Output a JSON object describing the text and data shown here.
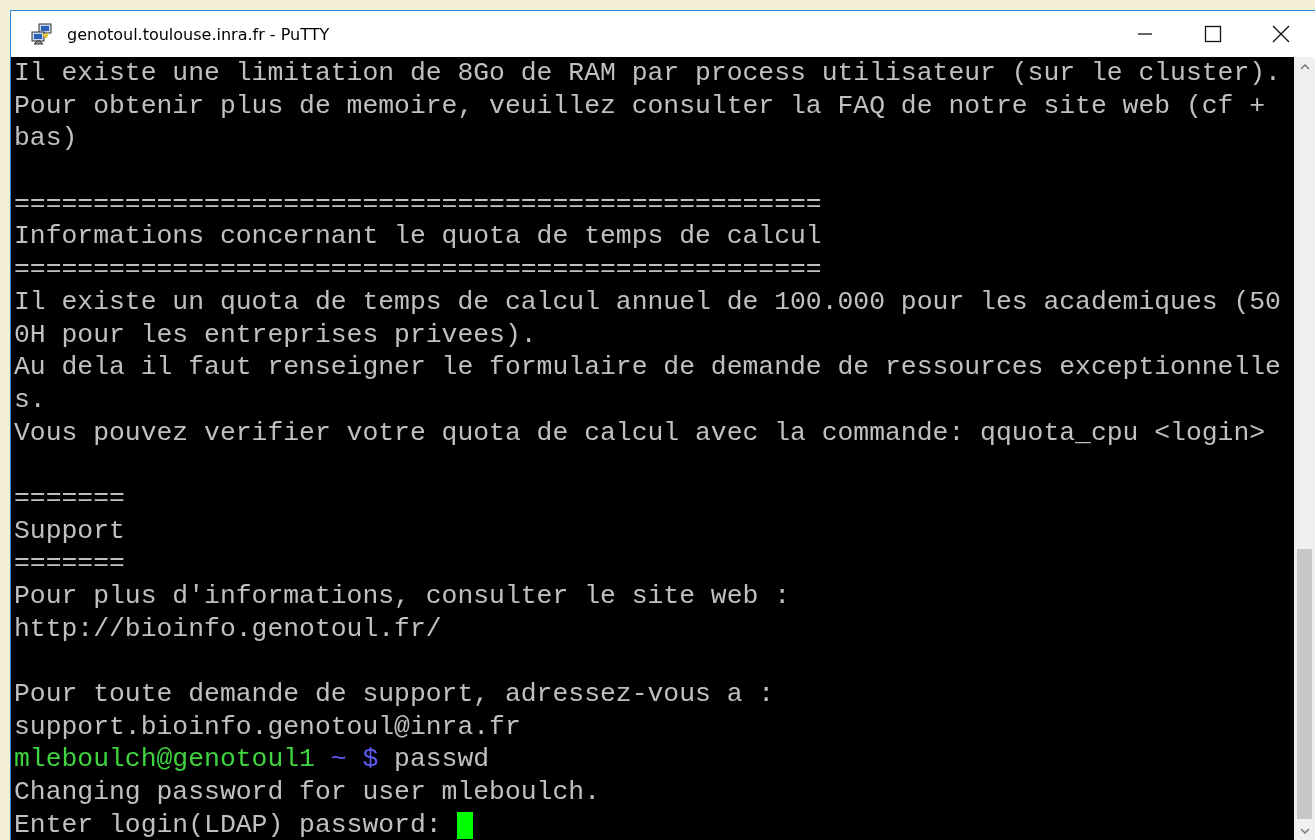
{
  "window": {
    "title": "genotoul.toulouse.inra.fr - PuTTY"
  },
  "terminal": {
    "lines": [
      {
        "kind": "text",
        "text": "Il existe une limitation de 8Go de RAM par process utilisateur (sur le cluster)."
      },
      {
        "kind": "text",
        "text": "Pour obtenir plus de memoire, veuillez consulter la FAQ de notre site web (cf +"
      },
      {
        "kind": "text",
        "text": "bas)"
      },
      {
        "kind": "blank"
      },
      {
        "kind": "text",
        "text": "==================================================="
      },
      {
        "kind": "text",
        "text": "Informations concernant le quota de temps de calcul"
      },
      {
        "kind": "text",
        "text": "==================================================="
      },
      {
        "kind": "text",
        "text": "Il existe un quota de temps de calcul annuel de 100.000 pour les academiques (50"
      },
      {
        "kind": "text",
        "text": "0H pour les entreprises privees)."
      },
      {
        "kind": "text",
        "text": "Au dela il faut renseigner le formulaire de demande de ressources exceptionnelle"
      },
      {
        "kind": "text",
        "text": "s."
      },
      {
        "kind": "text",
        "text": "Vous pouvez verifier votre quota de calcul avec la commande: qquota_cpu <login>"
      },
      {
        "kind": "blank"
      },
      {
        "kind": "text",
        "text": "======="
      },
      {
        "kind": "text",
        "text": "Support"
      },
      {
        "kind": "text",
        "text": "======="
      },
      {
        "kind": "text",
        "text": "Pour plus d'informations, consulter le site web :"
      },
      {
        "kind": "text",
        "text": "http://bioinfo.genotoul.fr/"
      },
      {
        "kind": "blank"
      },
      {
        "kind": "text",
        "text": "Pour toute demande de support, adressez-vous a :"
      },
      {
        "kind": "text",
        "text": "support.bioinfo.genotoul@inra.fr"
      },
      {
        "kind": "prompt",
        "user_host": "mleboulch@genotoul1",
        "path": "~",
        "symbol": "$",
        "command": "passwd"
      },
      {
        "kind": "text",
        "text": "Changing password for user mleboulch."
      },
      {
        "kind": "input",
        "text": "Enter login(LDAP) password:",
        "cursor": true
      }
    ]
  }
}
